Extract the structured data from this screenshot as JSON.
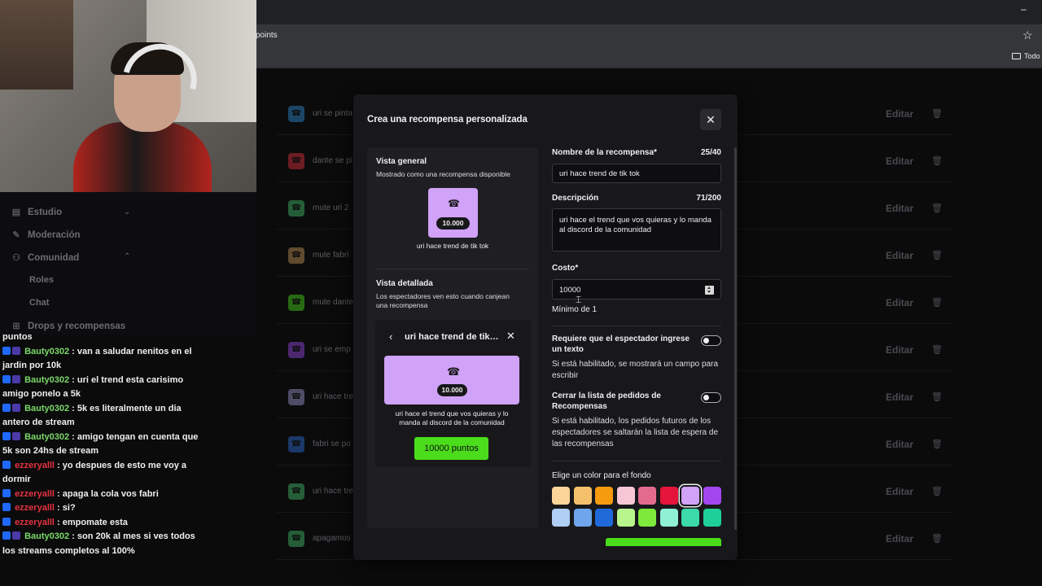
{
  "browser": {
    "address_fragment": "points",
    "bookmark_folder": "Todo"
  },
  "webcam": {
    "label": ""
  },
  "sidebar": {
    "items": [
      {
        "label": "Estudio",
        "icon": "video-icon"
      },
      {
        "label": "Moderación",
        "icon": "wrench-icon"
      },
      {
        "label": "Comunidad",
        "icon": "people-icon"
      },
      {
        "label": "Drops y recompensas",
        "icon": "gift-icon"
      }
    ],
    "subitems": [
      "Roles",
      "Chat"
    ]
  },
  "rewards": [
    {
      "title": "uri se pinta",
      "color": "#2f8fd8"
    },
    {
      "title": "dante se pi",
      "color": "#e5323f"
    },
    {
      "title": "mute uri 2",
      "color": "#45c46e"
    },
    {
      "title": "mute fabri",
      "color": "#c79a5a"
    },
    {
      "title": "mute dante",
      "color": "#4bdc1c"
    },
    {
      "title": "uri se emp",
      "color": "#9b4be8"
    },
    {
      "title": "uri hace tre",
      "color": "#9d9dd6"
    },
    {
      "title": "fabri se po",
      "color": "#2f6fd8"
    },
    {
      "title": "uri hace tre",
      "color": "#45c46e"
    },
    {
      "title": "apagamos",
      "color": "#45c46e"
    }
  ],
  "row_edit_label": "Editar",
  "chat": [
    {
      "user": "",
      "text": "puntos",
      "color": "none"
    },
    {
      "user": "Bauty0302",
      "text": "van a saludar nenitos en el jardin por 10k",
      "color": "green"
    },
    {
      "user": "Bauty0302",
      "text": "uri el trend esta carisimo amigo ponelo a 5k",
      "color": "green"
    },
    {
      "user": "Bauty0302",
      "text": "5k es literalmente un dia antero de stream",
      "color": "green"
    },
    {
      "user": "Bauty0302",
      "text": "amigo tengan en cuenta que 5k son 24hs de stream",
      "color": "green"
    },
    {
      "user": "ezzeryalll",
      "text": "yo despues de esto me voy a dormir",
      "color": "red"
    },
    {
      "user": "ezzeryalll",
      "text": "apaga la cola vos fabri",
      "color": "red"
    },
    {
      "user": "ezzeryalll",
      "text": "si?",
      "color": "red"
    },
    {
      "user": "ezzeryalll",
      "text": "empomate esta",
      "color": "red"
    },
    {
      "user": "Bauty0302",
      "text": "son 20k al mes si ves todos los streams completos al 100%",
      "color": "green"
    }
  ],
  "modal": {
    "title": "Crea una recompensa personalizada",
    "preview": {
      "general_title": "Vista general",
      "general_sub": "Mostrado como una recompensa disponible",
      "cost_short": "10.000",
      "reward_name": "uri hace trend de tik tok",
      "detail_title": "Vista detallada",
      "detail_sub": "Los espectadores ven esto cuando canjean una recompensa",
      "card_title": "uri hace trend de tik tok",
      "card_desc": "uri hace el trend que vos quieras y lo manda al discord de la comunidad",
      "redeem_button": "10000 puntos"
    },
    "form": {
      "name_label": "Nombre de la recompensa*",
      "name_count": "25/40",
      "name_value": "uri hace trend de tik tok",
      "desc_label": "Descripción",
      "desc_count": "71/200",
      "desc_value": "uri hace el trend que vos quieras y lo manda al discord de la comunidad",
      "cost_label": "Costo*",
      "cost_value": "10000",
      "cost_hint": "Mínimo de 1",
      "require_input_label": "Requiere que el espectador ingrese un texto",
      "require_input_help": "Si está habilitado, se mostrará un campo para escribir",
      "skip_queue_label": "Cerrar la lista de pedidos de Recompensas",
      "skip_queue_help": "Si está habilitado, los pedidos futuros de los espectadores se saltarán la lista de espera de las recompensas",
      "color_label": "Elige un color para el fondo",
      "swatches": [
        "#fcd59a",
        "#f5c06b",
        "#f49b0f",
        "#f8c7d6",
        "#e36b8e",
        "#e5143b",
        "#d0a2f8",
        "#a346f0",
        "#b0cdf4",
        "#6ea5ec",
        "#1f69d9",
        "#b9f58d",
        "#7ee83b",
        "#8ff0d6",
        "#3cd9ab",
        "#1ecf9a"
      ],
      "selected_swatch": 6
    }
  }
}
